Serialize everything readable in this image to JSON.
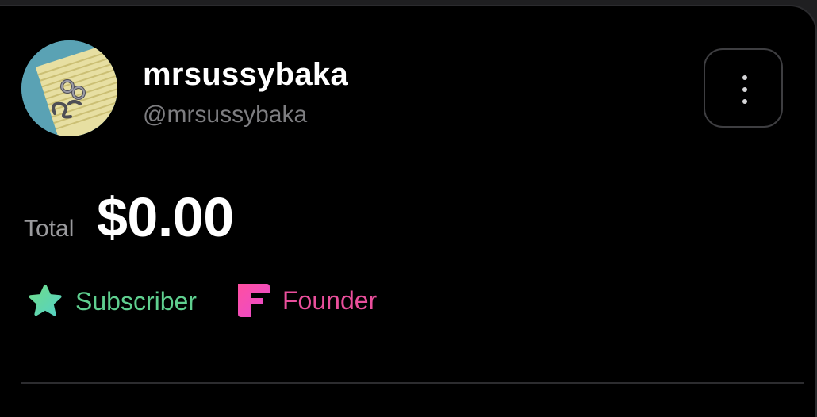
{
  "profile": {
    "display_name": "mrsussybaka",
    "handle": "@mrsussybaka",
    "avatar_icon": "avatar-image"
  },
  "menu": {
    "icon": "more-vertical-icon"
  },
  "total": {
    "label": "Total",
    "value": "$0.00"
  },
  "badges": [
    {
      "label": "Subscriber",
      "icon": "star-icon",
      "color": "#5fcf8f"
    },
    {
      "label": "Founder",
      "icon": "founder-f-icon",
      "color": "#ea4f9c"
    }
  ],
  "colors": {
    "background": "#000000",
    "primary_text": "#ffffff",
    "secondary_text": "#7d7d80",
    "subscriber": "#5fcf8f",
    "founder": "#ea4f9c"
  }
}
